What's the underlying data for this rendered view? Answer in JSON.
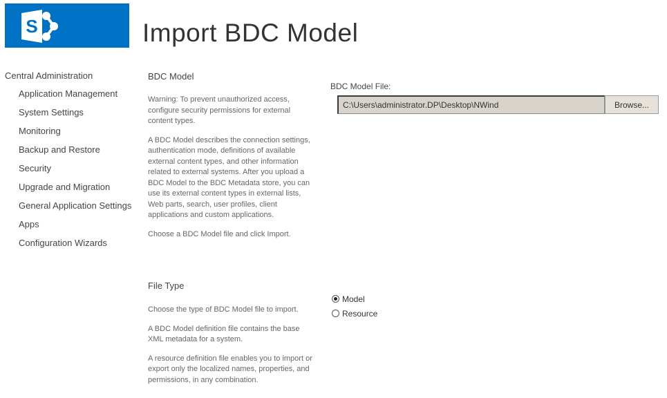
{
  "header": {
    "logo_icon": "sharepoint-logo-icon",
    "logo_letter": "S",
    "title": "Import BDC Model"
  },
  "sidebar": {
    "root": "Central Administration",
    "items": [
      {
        "label": "Application Management"
      },
      {
        "label": "System Settings"
      },
      {
        "label": "Monitoring"
      },
      {
        "label": "Backup and Restore"
      },
      {
        "label": "Security"
      },
      {
        "label": "Upgrade and Migration"
      },
      {
        "label": "General Application Settings"
      },
      {
        "label": "Apps"
      },
      {
        "label": "Configuration Wizards"
      }
    ]
  },
  "bdc_section": {
    "title": "BDC Model",
    "paragraphs": [
      "Warning: To prevent unauthorized access, configure security permissions for external content types.",
      "A BDC Model describes the connection settings, authentication mode, definitions of available external content types, and other information related to external systems. After you upload a BDC Model to the BDC Metadata store, you can use its external content types in external lists, Web parts, search, user profiles, client applications and custom applications.",
      "Choose a BDC Model file and click Import."
    ],
    "file_label": "BDC Model File:",
    "file_value": "C:\\Users\\administrator.DP\\Desktop\\NWind",
    "browse_label": "Browse..."
  },
  "file_type_section": {
    "title": "File Type",
    "paragraphs": [
      "Choose the type of BDC Model file to import.",
      "A BDC Model definition file contains the base XML metadata for a system.",
      "A resource definition file enables you to import or export only the localized names, properties, and permissions, in any combination."
    ],
    "options": [
      {
        "label": "Model",
        "checked": true
      },
      {
        "label": "Resource",
        "checked": false
      }
    ]
  },
  "colors": {
    "brand": "#0072c6"
  }
}
